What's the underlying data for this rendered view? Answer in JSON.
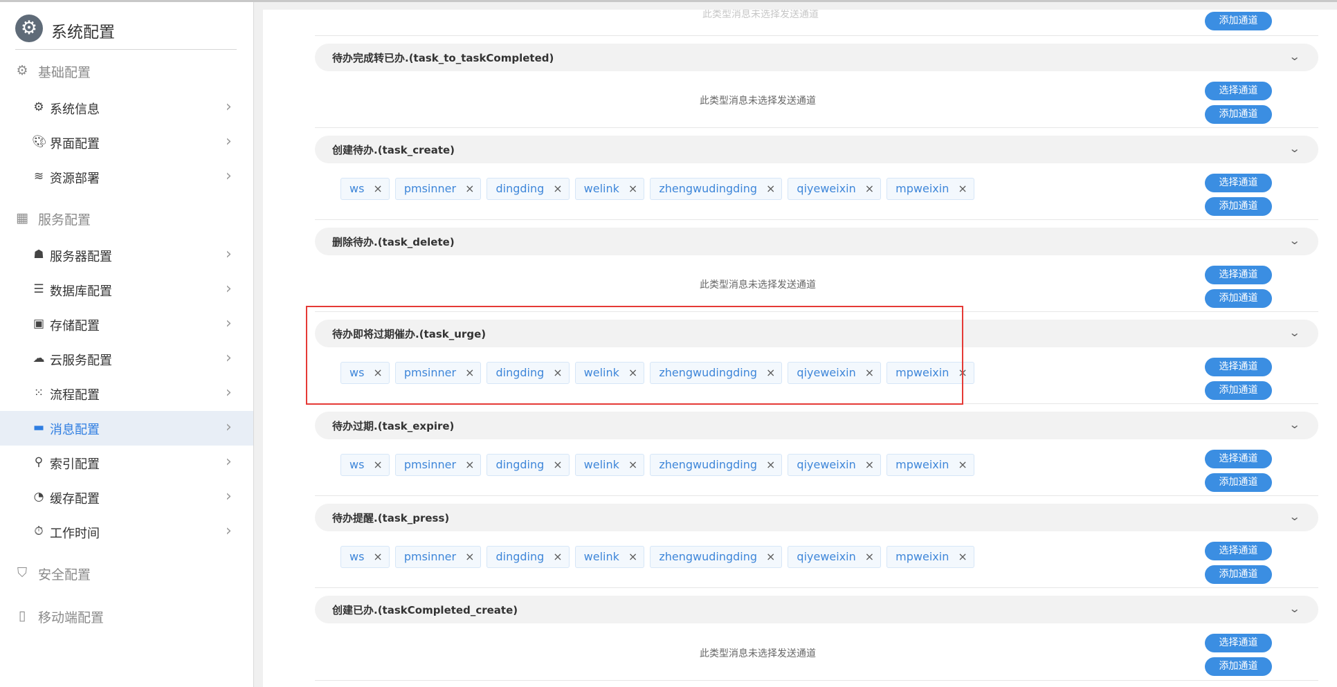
{
  "sidebar": {
    "title": "系统配置",
    "logo_icon": "gear-icon",
    "groups": [
      {
        "label": "基础配置",
        "icon": "gear-icon",
        "items": [
          {
            "label": "系统信息",
            "icon": "gear-icon"
          },
          {
            "label": "界面配置",
            "icon": "palette-icon"
          },
          {
            "label": "资源部署",
            "icon": "layers-icon"
          }
        ]
      },
      {
        "label": "服务配置",
        "icon": "building-icon",
        "items": [
          {
            "label": "服务器配置",
            "icon": "server-hand-icon"
          },
          {
            "label": "数据库配置",
            "icon": "database-icon"
          },
          {
            "label": "存储配置",
            "icon": "archive-icon"
          },
          {
            "label": "云服务配置",
            "icon": "cloud-icon"
          },
          {
            "label": "流程配置",
            "icon": "flow-icon"
          },
          {
            "label": "消息配置",
            "icon": "message-icon",
            "active": true
          },
          {
            "label": "索引配置",
            "icon": "search-icon"
          },
          {
            "label": "缓存配置",
            "icon": "pie-icon"
          },
          {
            "label": "工作时间",
            "icon": "stopwatch-icon"
          }
        ]
      },
      {
        "label": "安全配置",
        "icon": "shield-icon",
        "items": []
      },
      {
        "label": "移动端配置",
        "icon": "mobile-icon",
        "items": []
      }
    ]
  },
  "main": {
    "faded_top_text": "此类型消息未选择发送通道",
    "select_label": "选择通道",
    "add_label": "添加通道",
    "empty_text": "此类型消息未选择发送通道",
    "channels": [
      "ws",
      "pmsinner",
      "dingding",
      "welink",
      "zhengwudingding",
      "qiyeweixin",
      "mpweixin"
    ],
    "sections": [
      {
        "title": "待办完成转已办.(task_to_taskCompleted)",
        "has_channels": false
      },
      {
        "title": "创建待办.(task_create)",
        "has_channels": true
      },
      {
        "title": "删除待办.(task_delete)",
        "has_channels": false
      },
      {
        "title": "待办即将过期催办.(task_urge)",
        "has_channels": true,
        "highlighted": true
      },
      {
        "title": "待办过期.(task_expire)",
        "has_channels": true
      },
      {
        "title": "待办提醒.(task_press)",
        "has_channels": true
      },
      {
        "title": "创建已办.(taskCompleted_create)",
        "has_channels": false
      }
    ]
  }
}
